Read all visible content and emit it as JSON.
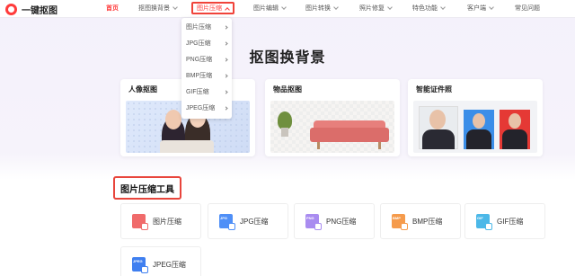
{
  "brand": {
    "name": "一键抠图"
  },
  "nav": {
    "items": [
      {
        "label": "首页",
        "has_chevron": false
      },
      {
        "label": "抠图换背景",
        "has_chevron": true
      },
      {
        "label": "图片压缩",
        "has_chevron": true,
        "active": true
      },
      {
        "label": "图片编辑",
        "has_chevron": true
      },
      {
        "label": "图片转换",
        "has_chevron": true
      },
      {
        "label": "照片修复",
        "has_chevron": true
      },
      {
        "label": "特色功能",
        "has_chevron": true
      },
      {
        "label": "客户端",
        "has_chevron": true
      },
      {
        "label": "常见问题",
        "has_chevron": false
      }
    ]
  },
  "dropdown": {
    "items": [
      "图片压缩",
      "JPG压缩",
      "PNG压缩",
      "BMP压缩",
      "GIF压缩",
      "JPEG压缩"
    ]
  },
  "hero": {
    "title": "抠图换背景",
    "cards": [
      {
        "title": "人像抠图"
      },
      {
        "title": "物品抠图"
      },
      {
        "title": "智能证件照"
      }
    ]
  },
  "section": {
    "title": "图片压缩工具",
    "tools": [
      {
        "label": "图片压缩",
        "icon": "image-compress-icon",
        "color": "#f06b6b",
        "tag": ""
      },
      {
        "label": "JPG压缩",
        "icon": "jpg-icon",
        "color": "#4f8ff7",
        "tag": "JPG"
      },
      {
        "label": "PNG压缩",
        "icon": "png-icon",
        "color": "#a98cf0",
        "tag": "PNG"
      },
      {
        "label": "BMP压缩",
        "icon": "bmp-icon",
        "color": "#f59b4c",
        "tag": "BMP"
      },
      {
        "label": "GIF压缩",
        "icon": "gif-icon",
        "color": "#4cb8e8",
        "tag": "GIF"
      },
      {
        "label": "JPEG压缩",
        "icon": "jpeg-icon",
        "color": "#3f7ff0",
        "tag": "JPEG"
      }
    ]
  },
  "colors": {
    "accent": "#ff3b3b",
    "highlight_border": "#e8453c"
  }
}
